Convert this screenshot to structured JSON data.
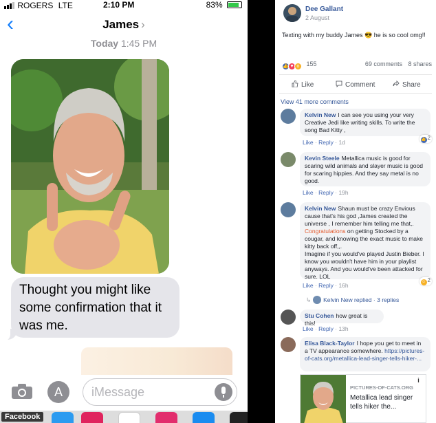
{
  "imessage": {
    "status": {
      "carrier": "ROGERS",
      "network": "LTE",
      "time": "2:10 PM",
      "battery": "83%",
      "battery_level": 0.83
    },
    "contact_name": "James",
    "timestamp_day": "Today",
    "timestamp_time": "1:45 PM",
    "message_text": "Thought you might like some confirmation that it was me.",
    "input_placeholder": "iMessage",
    "source_badge": "Facebook"
  },
  "facebook": {
    "poster_name": "Dee Gallant",
    "post_date": "2 August",
    "post_text": "Texting with my buddy James 😎 he is so cool omg!!",
    "reaction_count": "155",
    "comments_count": "69 comments",
    "shares_count": "8 shares",
    "actions": {
      "like": "Like",
      "comment": "Comment",
      "share": "Share"
    },
    "view_more": "View 41 more comments",
    "comments": [
      {
        "name": "Kelvin New",
        "text": "I can see you using your very Creative Jedi like writing skills. To write the song Bad Kitty ,",
        "like": "Like",
        "reply": "Reply",
        "age": "1d",
        "reactions": "2"
      },
      {
        "name": "Kevin Steele",
        "text": "Metallica music is good for scaring wild animals and slayer music is good for scaring hippies. And they say metal is no good.",
        "like": "Like",
        "reply": "Reply",
        "age": "19h",
        "reactions": ""
      },
      {
        "name": "Kelvin New",
        "text_a": "Shaun must be crazy Envious cause that's his god ,James created the universe , I remember him telling me that,.",
        "highlight": "Congratulations",
        "text_b": "on getting Stocked by a cougar, and knowing the exact music to make kitty back off,,.",
        "text_c": "Imagine if you would've played Justin Bieber. I know you wouldn't have him in your playlist anyways. And you would've been attacked for sure. LOL",
        "like": "Like",
        "reply": "Reply",
        "age": "16h",
        "reactions": "2"
      },
      {
        "name": "Stu Cohen",
        "text": "how great is this!",
        "like": "Like",
        "reply": "Reply",
        "age": "13h",
        "reactions": ""
      },
      {
        "name": "Elisa Black-Taylor",
        "text": "I hope you get to meet in a TV appearance somewhere.",
        "link": "https://pictures-of-cats.org/metallica-lead-singer-tells-hiker-...",
        "reactions": ""
      }
    ],
    "replied": {
      "who": "Kelvin New replied",
      "sep": "·",
      "count": "3 replies"
    },
    "link_card": {
      "source": "PICTURES-OF-CATS.ORG",
      "title": "Metallica lead singer tells hiker the...",
      "info": "i"
    }
  },
  "colors": {
    "ios_blue": "#147efb",
    "fb_blue": "#365899",
    "bubble_gray": "#e5e5ea"
  },
  "icons": [
    "signal-bars-icon",
    "battery-icon",
    "back-chevron-icon",
    "camera-icon",
    "app-store-icon",
    "microphone-icon",
    "like-icon",
    "comment-icon",
    "share-icon",
    "info-icon"
  ]
}
